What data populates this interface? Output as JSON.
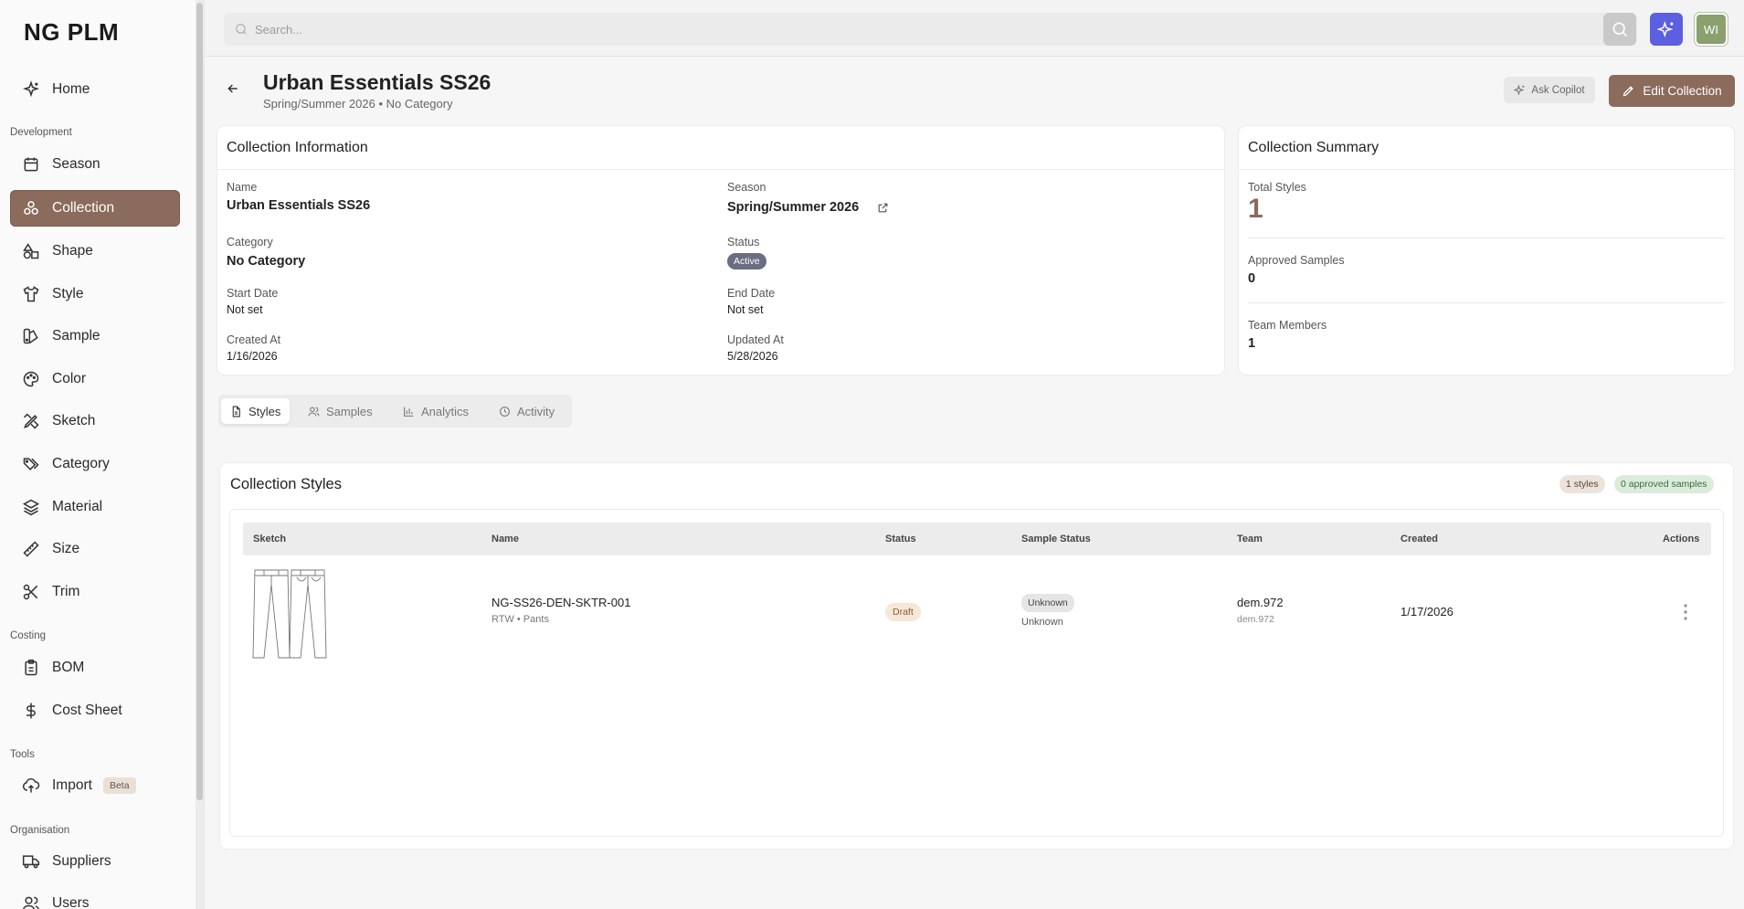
{
  "app": {
    "logo": "NG PLM"
  },
  "sidebar": {
    "sections": {
      "development": "Development",
      "costing": "Costing",
      "tools": "Tools",
      "organisation": "Organisation"
    },
    "items": [
      {
        "label": "Home",
        "icon": "sparkle-icon"
      },
      {
        "label": "Season",
        "icon": "calendar-icon"
      },
      {
        "label": "Collection",
        "icon": "collection-icon"
      },
      {
        "label": "Shape",
        "icon": "shapes-icon"
      },
      {
        "label": "Style",
        "icon": "shirt-icon"
      },
      {
        "label": "Sample",
        "icon": "swatch-icon"
      },
      {
        "label": "Color",
        "icon": "palette-icon"
      },
      {
        "label": "Sketch",
        "icon": "pencil-ruler-icon"
      },
      {
        "label": "Category",
        "icon": "tags-icon"
      },
      {
        "label": "Material",
        "icon": "layers-icon"
      },
      {
        "label": "Size",
        "icon": "ruler-icon"
      },
      {
        "label": "Trim",
        "icon": "scissors-icon"
      },
      {
        "label": "BOM",
        "icon": "clipboard-icon"
      },
      {
        "label": "Cost Sheet",
        "icon": "dollar-icon"
      },
      {
        "label": "Import",
        "icon": "cloud-upload-icon",
        "badge": "Beta"
      },
      {
        "label": "Suppliers",
        "icon": "truck-icon"
      },
      {
        "label": "Users",
        "icon": "users-icon"
      }
    ],
    "active": "Collection",
    "accent": "#8b6b5c"
  },
  "topbar": {
    "search_placeholder": "Search...",
    "avatar_initials": "WI"
  },
  "header": {
    "title": "Urban Essentials SS26",
    "subtitle": "Spring/Summer 2026 • No Category",
    "ask_copilot": "Ask Copilot",
    "edit_collection": "Edit Collection"
  },
  "info": {
    "title": "Collection Information",
    "name_label": "Name",
    "name": "Urban Essentials SS26",
    "season_label": "Season",
    "season": "Spring/Summer 2026",
    "category_label": "Category",
    "category": "No Category",
    "status_label": "Status",
    "status": "Active",
    "start_label": "Start Date",
    "start": "Not set",
    "end_label": "End Date",
    "end": "Not set",
    "created_label": "Created At",
    "created": "1/16/2026",
    "updated_label": "Updated At",
    "updated": "5/28/2026"
  },
  "summary": {
    "title": "Collection Summary",
    "total_styles_label": "Total Styles",
    "total_styles": "1",
    "approved_samples_label": "Approved Samples",
    "approved_samples": "0",
    "team_members_label": "Team Members",
    "team_members": "1"
  },
  "tabs": [
    {
      "label": "Styles",
      "icon": "file-icon"
    },
    {
      "label": "Samples",
      "icon": "users-icon"
    },
    {
      "label": "Analytics",
      "icon": "bar-chart-icon"
    },
    {
      "label": "Activity",
      "icon": "clock-icon"
    }
  ],
  "styles": {
    "title": "Collection Styles",
    "count_badge": "1 styles",
    "approved_badge": "0 approved samples",
    "columns": [
      "Sketch",
      "Name",
      "Status",
      "Sample Status",
      "Team",
      "Created",
      "Actions"
    ],
    "rows": [
      {
        "name": "NG-SS26-DEN-SKTR-001",
        "meta": "RTW • Pants",
        "status": "Draft",
        "sample_status": "Unknown",
        "sample_status_sub": "Unknown",
        "team": "dem.972",
        "team_sub": "dem.972",
        "created": "1/17/2026"
      }
    ]
  }
}
